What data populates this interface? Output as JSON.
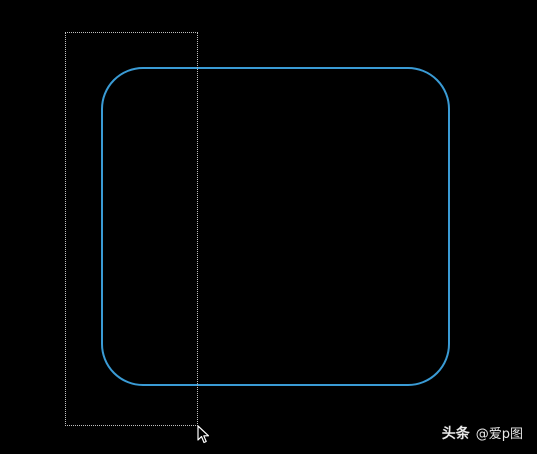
{
  "canvas": {
    "background": "#000000",
    "shape_stroke_color": "#3a9bd5",
    "selection_color": "#bfbfbf"
  },
  "cursor": {
    "icon": "arrow-cursor-icon"
  },
  "watermark": {
    "brand": "头条",
    "handle": "@爱p图"
  }
}
